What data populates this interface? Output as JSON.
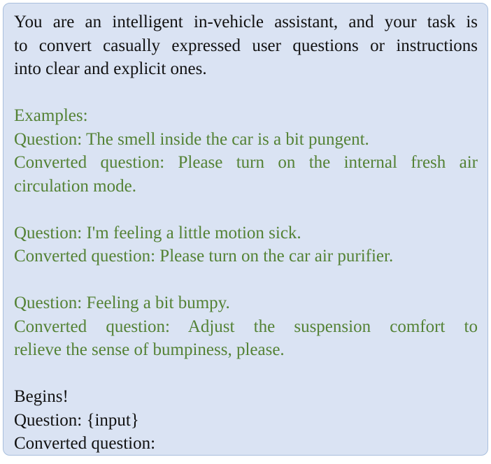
{
  "colors": {
    "box_background": "#dae3f3",
    "box_border": "#a9bfdd",
    "instruction_text": "#111111",
    "example_text": "#548235"
  },
  "prompt": {
    "intro_lines": [
      "You are an intelligent in-vehicle assistant, and your task is",
      "to convert casually expressed user questions or instructions",
      "into clear and explicit ones."
    ],
    "examples_heading": "Examples:",
    "example1": {
      "question": "Question: The smell inside the car is a bit pungent.",
      "converted_lines": [
        "Converted question: Please turn on the internal fresh air",
        "circulation mode."
      ]
    },
    "example2": {
      "question": "Question: I'm feeling a little motion sick.",
      "converted": "Converted question: Please turn on the car air purifier."
    },
    "example3": {
      "question": "Question: Feeling a bit bumpy.",
      "converted_lines": [
        "Converted question: Adjust the suspension comfort to",
        "relieve the sense of bumpiness, please."
      ]
    },
    "begin_label": "Begins!",
    "input_question": "Question: {input}",
    "output_label": "Converted question:"
  }
}
